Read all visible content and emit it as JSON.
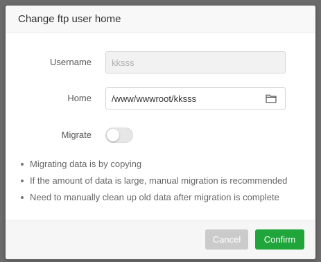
{
  "dialog": {
    "title": "Change ftp user home"
  },
  "form": {
    "username_label": "Username",
    "username_value": "kksss",
    "home_label": "Home",
    "home_value": "/www/wwwroot/kksss",
    "migrate_label": "Migrate",
    "migrate_on": false,
    "folder_icon": "folder-icon"
  },
  "notes": [
    "Migrating data is by copying",
    "If the amount of data is large, manual migration is recommended",
    "Need to manually clean up old data after migration is complete"
  ],
  "footer": {
    "cancel_label": "Cancel",
    "confirm_label": "Confirm"
  },
  "colors": {
    "confirm": "#20a53a",
    "cancel": "#cbcbcb"
  }
}
